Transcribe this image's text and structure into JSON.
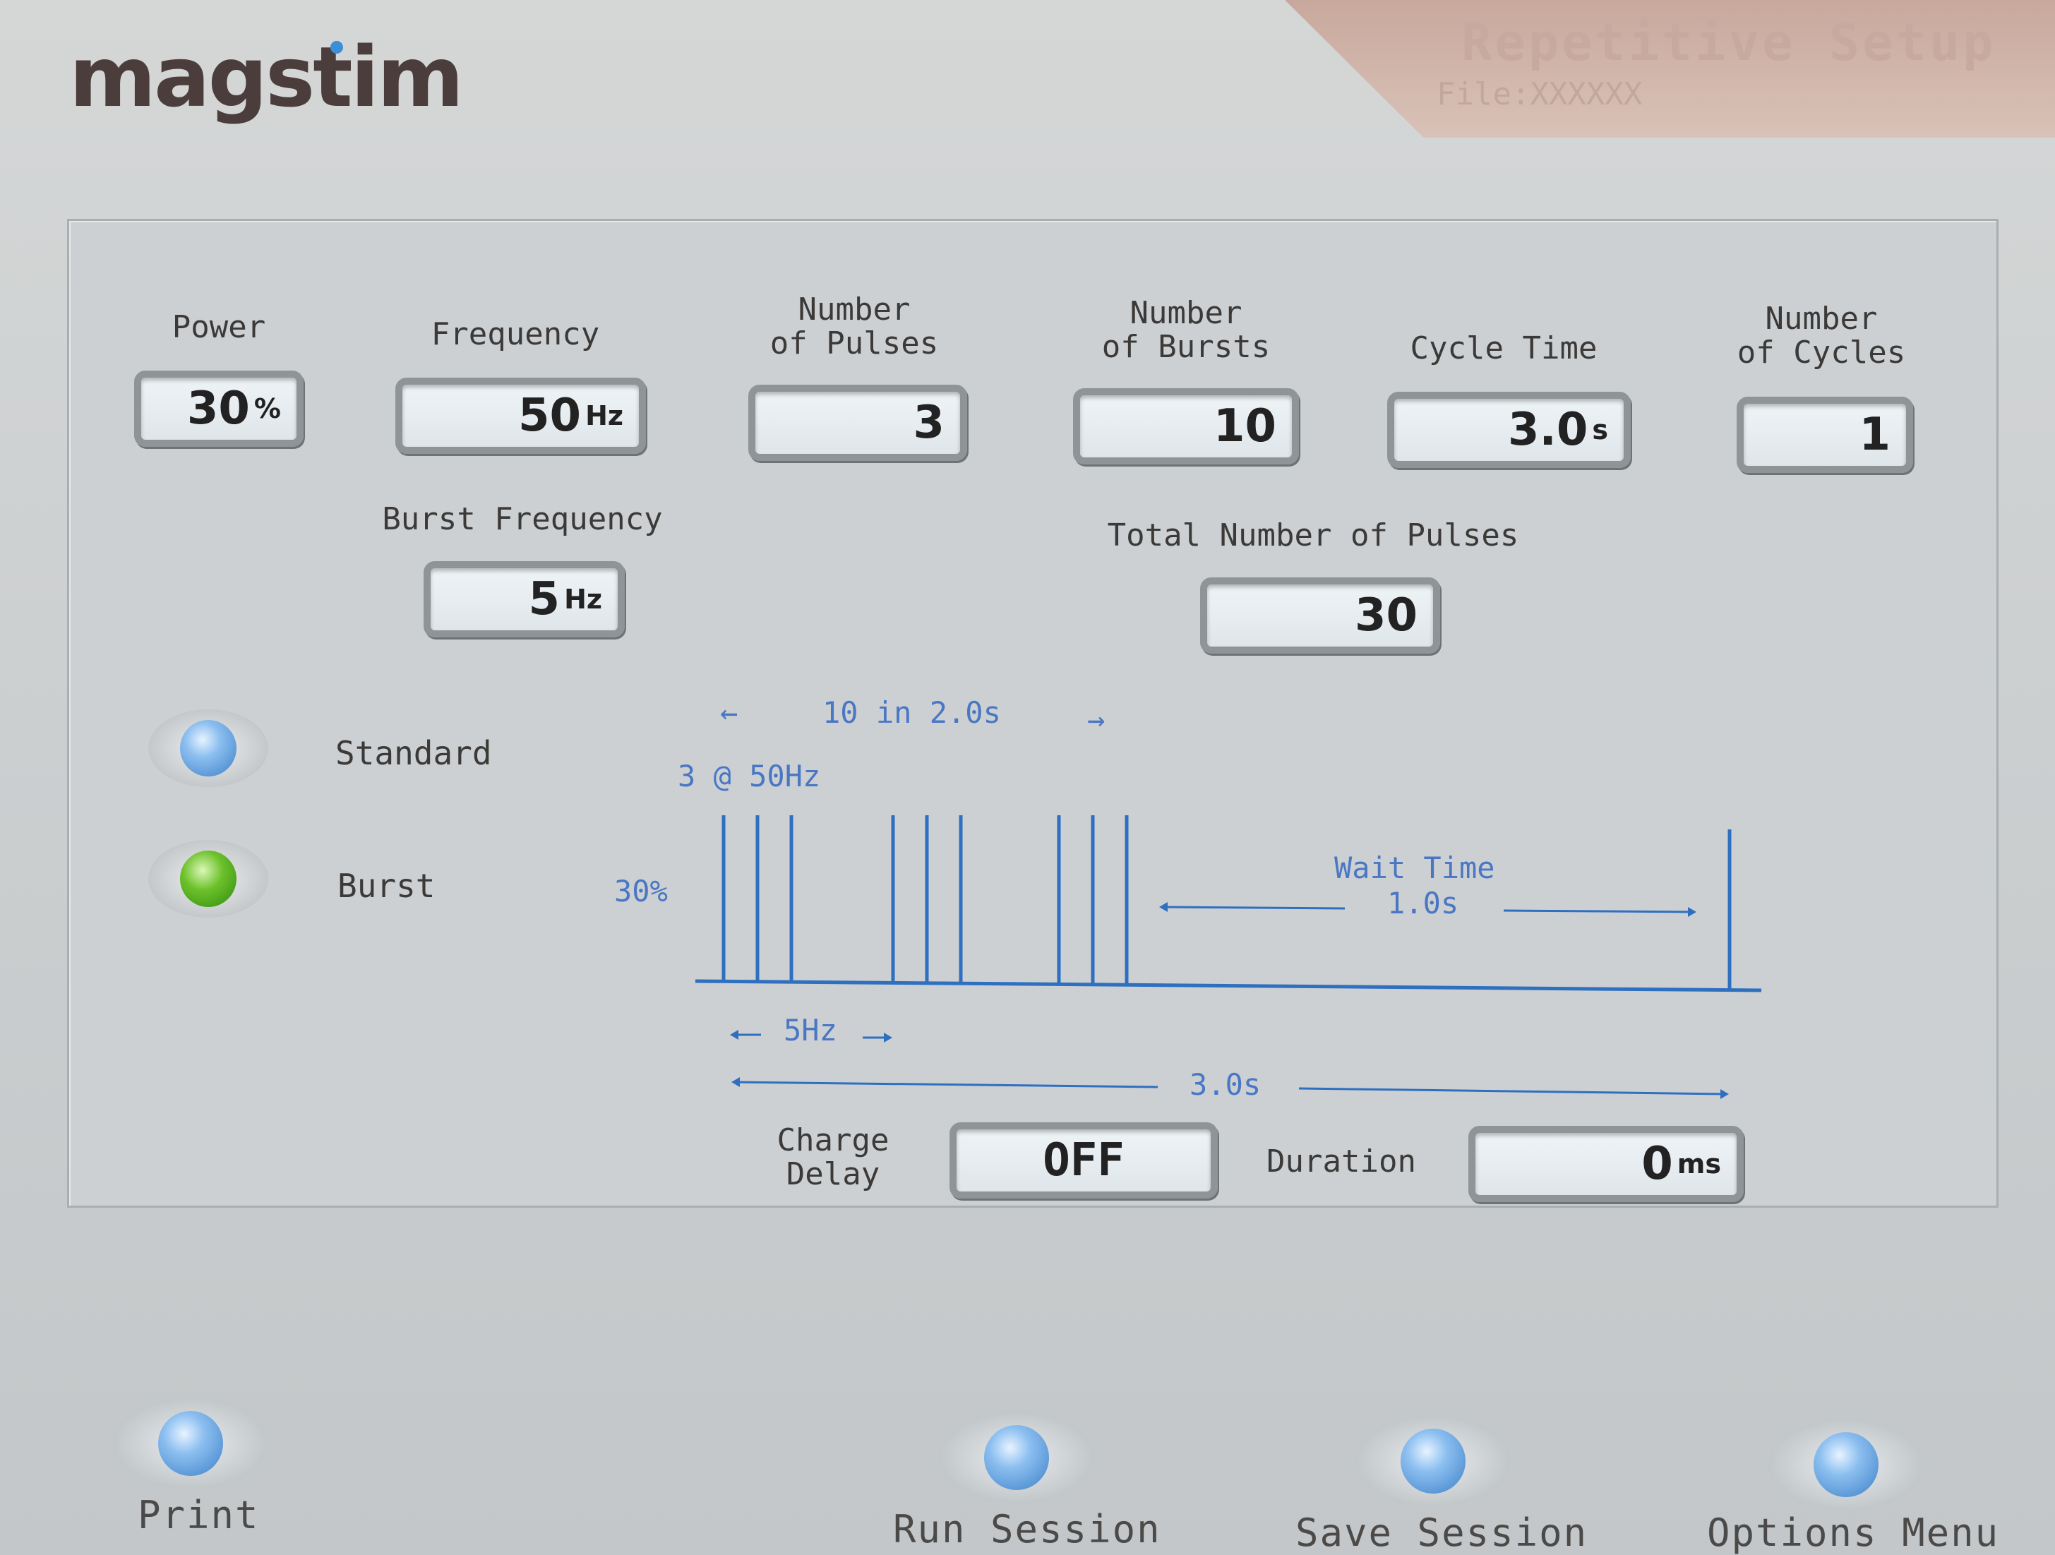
{
  "logo": "magstim",
  "header": {
    "title": "Repetitive Setup",
    "file": "File:XXXXXX"
  },
  "params": {
    "power": {
      "label": "Power",
      "value": "30",
      "unit": "%"
    },
    "frequency": {
      "label": "Frequency",
      "value": "50",
      "unit": "Hz"
    },
    "num_pulses": {
      "label": "Number\nof Pulses",
      "value": "3",
      "unit": ""
    },
    "num_bursts": {
      "label": "Number\nof Bursts",
      "value": "10",
      "unit": ""
    },
    "cycle_time": {
      "label": "Cycle Time",
      "value": "3.0",
      "unit": "s"
    },
    "num_cycles": {
      "label": "Number\nof Cycles",
      "value": "1",
      "unit": ""
    },
    "burst_frequency": {
      "label": "Burst Frequency",
      "value": "5",
      "unit": "Hz"
    },
    "total_pulses": {
      "label": "Total Number of Pulses",
      "value": "30",
      "unit": ""
    }
  },
  "mode": {
    "standard": {
      "label": "Standard",
      "selected": false,
      "color": "#3c7fc7"
    },
    "burst": {
      "label": "Burst",
      "selected": true,
      "color": "#6cc12a"
    }
  },
  "diagram": {
    "train_text": "10 in 2.0s",
    "burst_text": "3 @ 50Hz",
    "power_text": "30%",
    "wait_label": "Wait Time",
    "wait_value": "1.0s",
    "burst_freq_text": "5Hz",
    "cycle_text": "3.0s",
    "line_color": "#2f6fc0",
    "bursts": 3,
    "pulses_per_burst": 3
  },
  "charge_delay": {
    "label": "Charge\nDelay",
    "value": "OFF"
  },
  "duration": {
    "label": "Duration",
    "value": "0",
    "unit": "ms"
  },
  "nav": {
    "print": "Print",
    "run_session": "Run Session",
    "save_session": "Save Session",
    "options_menu": "Options Menu"
  }
}
